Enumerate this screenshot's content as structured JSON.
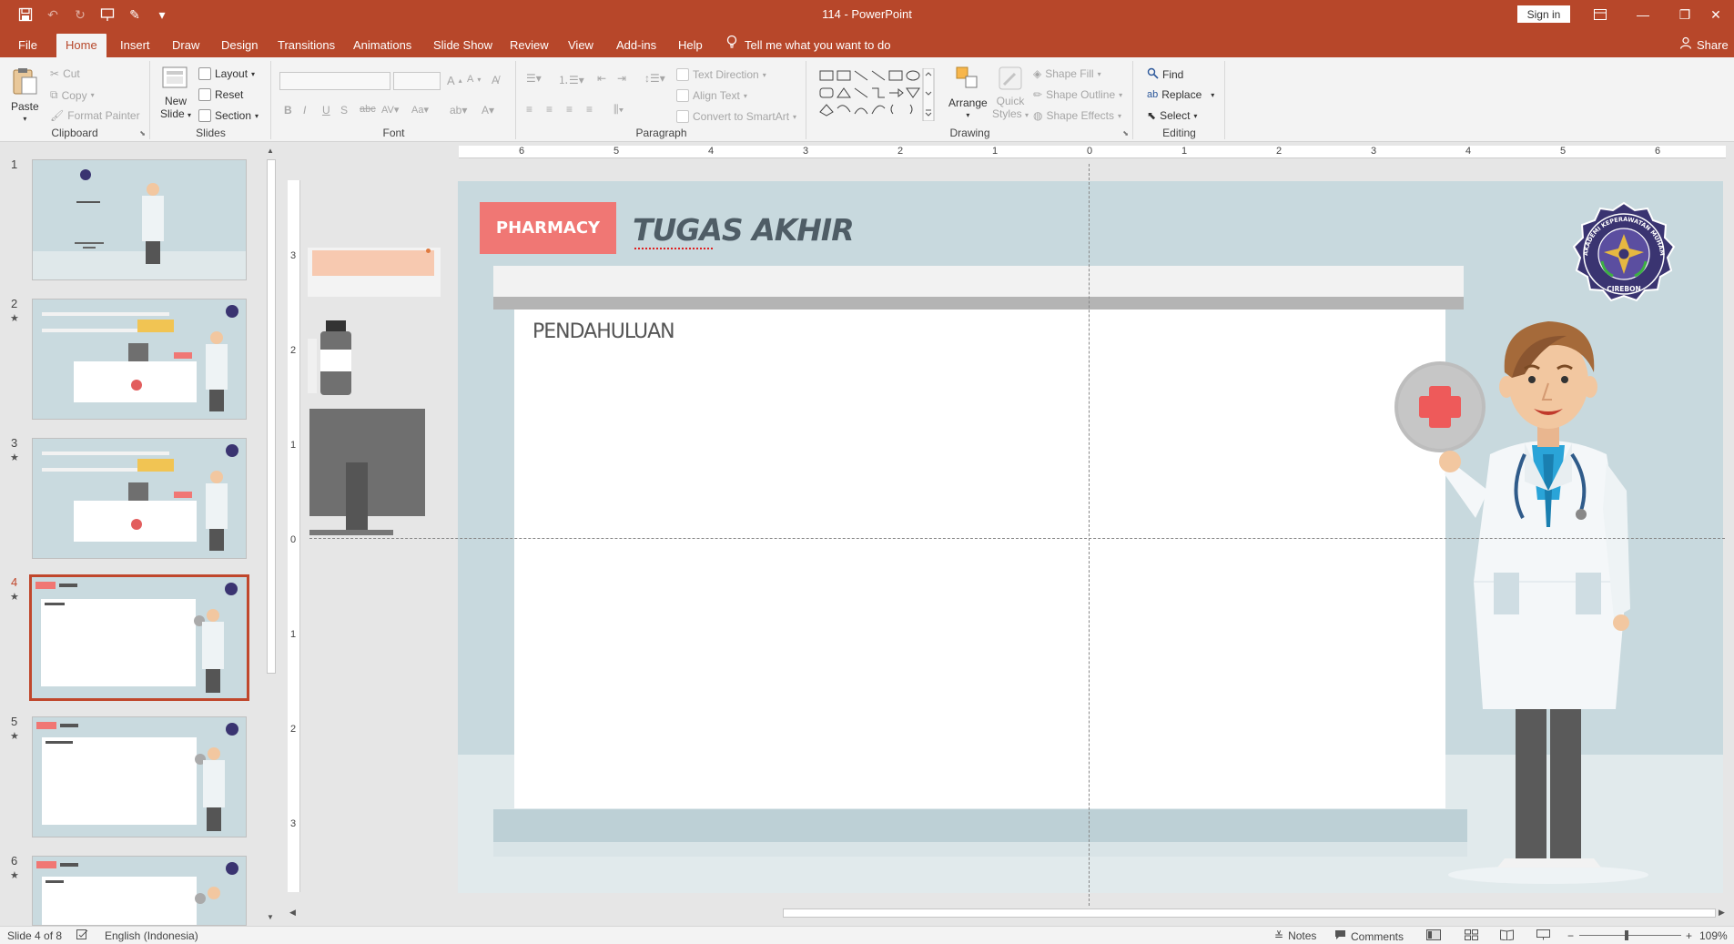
{
  "window": {
    "title": "114  -  PowerPoint",
    "sign_in": "Sign in",
    "share": "Share"
  },
  "menu": {
    "tabs": [
      "File",
      "Home",
      "Insert",
      "Draw",
      "Design",
      "Transitions",
      "Animations",
      "Slide Show",
      "Review",
      "View",
      "Add-ins",
      "Help"
    ],
    "active_tab": "Home",
    "tell_me": "Tell me what you want to do"
  },
  "ribbon": {
    "clipboard": {
      "label": "Clipboard",
      "paste": "Paste",
      "cut": "Cut",
      "copy": "Copy",
      "format_painter": "Format Painter"
    },
    "slides": {
      "label": "Slides",
      "new_slide_1": "New",
      "new_slide_2": "Slide",
      "layout": "Layout",
      "reset": "Reset",
      "section": "Section"
    },
    "font": {
      "label": "Font"
    },
    "paragraph": {
      "label": "Paragraph",
      "text_direction": "Text Direction",
      "align_text": "Align Text",
      "convert_smartart": "Convert to SmartArt"
    },
    "drawing": {
      "label": "Drawing",
      "arrange": "Arrange",
      "quick_styles_1": "Quick",
      "quick_styles_2": "Styles",
      "shape_fill": "Shape Fill",
      "shape_outline": "Shape Outline",
      "shape_effects": "Shape Effects"
    },
    "editing": {
      "label": "Editing",
      "find": "Find",
      "replace": "Replace",
      "select": "Select"
    }
  },
  "thumbnails": [
    {
      "num": "1",
      "star": ""
    },
    {
      "num": "2",
      "star": "★"
    },
    {
      "num": "3",
      "star": "★"
    },
    {
      "num": "4",
      "star": "★"
    },
    {
      "num": "5",
      "star": "★"
    },
    {
      "num": "6",
      "star": "★"
    }
  ],
  "ruler": {
    "h": [
      "6",
      "5",
      "4",
      "3",
      "2",
      "1",
      "0",
      "1",
      "2",
      "3",
      "4",
      "5",
      "6"
    ],
    "v": [
      "3",
      "2",
      "1",
      "0",
      "1",
      "2",
      "3"
    ]
  },
  "slide": {
    "badge": "PHARMACY",
    "title": "TUGAS AKHIR",
    "content_heading": "PENDAHULUAN",
    "logo_text": "AKADEMI KEPERAWATAN MUHAMMADIYAH",
    "logo_city": "CIREBON",
    "colors": {
      "background": "#c8d9de",
      "badge": "#f07774",
      "accent": "#b7472a"
    }
  },
  "status": {
    "slide_of": "Slide 4 of 8",
    "language": "English (Indonesia)",
    "notes": "Notes",
    "comments": "Comments",
    "zoom": "109%"
  }
}
